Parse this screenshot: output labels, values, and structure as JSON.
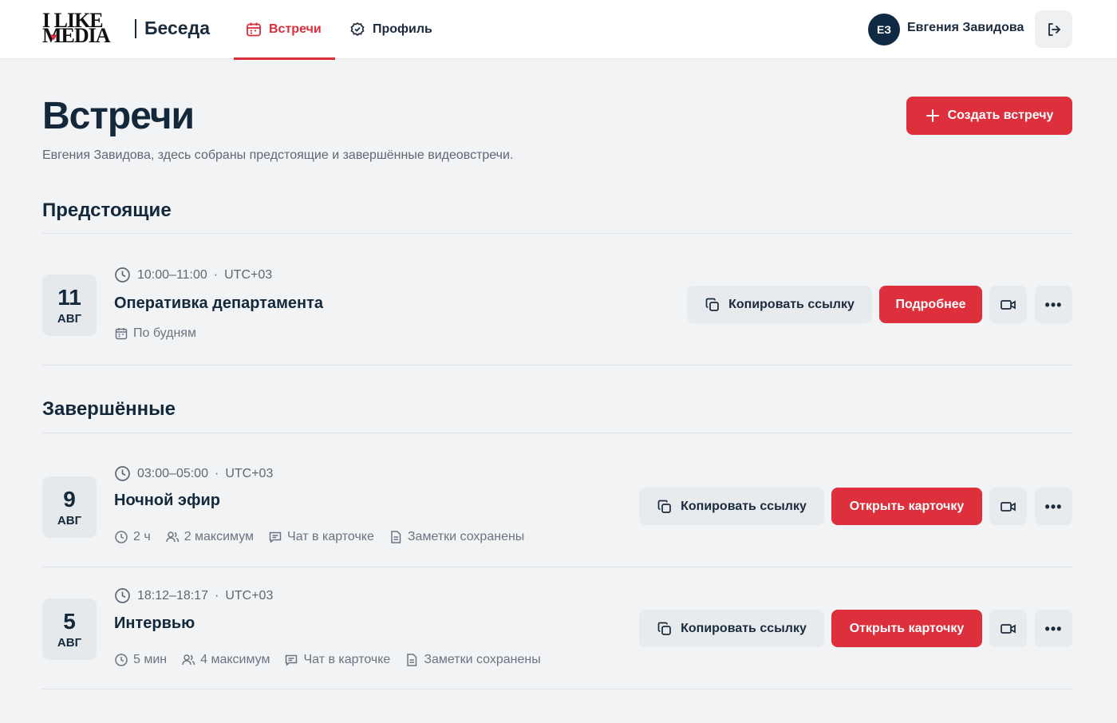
{
  "header": {
    "logo_line1": "I LIKE",
    "logo_line2": "MEDIA",
    "brand": "Беседа",
    "tabs": [
      {
        "label": "Встречи",
        "icon": "calendar-icon",
        "active": true
      },
      {
        "label": "Профиль",
        "icon": "profile-icon",
        "active": false
      }
    ],
    "user": {
      "initials": "ЕЗ",
      "name": "Евгения Завидова"
    },
    "logout_icon": "logout-icon"
  },
  "page": {
    "title": "Встречи",
    "subtitle": "Евгения Завидова, здесь собраны предстоящие и завершённые видеовстречи.",
    "create_button": "Создать встречу"
  },
  "upcoming": {
    "title": "Предстоящие",
    "meetings": [
      {
        "day": "11",
        "month": "АВГ",
        "time": "10:00–11:00",
        "tz": "UTC+03",
        "title": "Оперативка департамента",
        "recurrence": "По будням",
        "copy_label": "Копировать ссылку",
        "action_label": "Подробнее"
      }
    ]
  },
  "completed": {
    "title": "Завершённые",
    "meetings": [
      {
        "day": "9",
        "month": "АВГ",
        "time": "03:00–05:00",
        "tz": "UTC+03",
        "title": "Ночной эфир",
        "duration": "2 ч",
        "participants": "2 максимум",
        "chat": "Чат в карточке",
        "notes": "Заметки сохранены",
        "copy_label": "Копировать ссылку",
        "action_label": "Открыть карточку"
      },
      {
        "day": "5",
        "month": "АВГ",
        "time": "18:12–18:17",
        "tz": "UTC+03",
        "title": "Интервью",
        "duration": "5 мин",
        "participants": "4 максимум",
        "chat": "Чат в карточке",
        "notes": "Заметки сохранены",
        "copy_label": "Копировать ссылку",
        "action_label": "Открыть карточку"
      }
    ]
  },
  "time_separator": "·",
  "more_label": "•••",
  "colors": {
    "accent": "#dd2f3c",
    "dark": "#14283c",
    "avatar": "#102a44"
  }
}
